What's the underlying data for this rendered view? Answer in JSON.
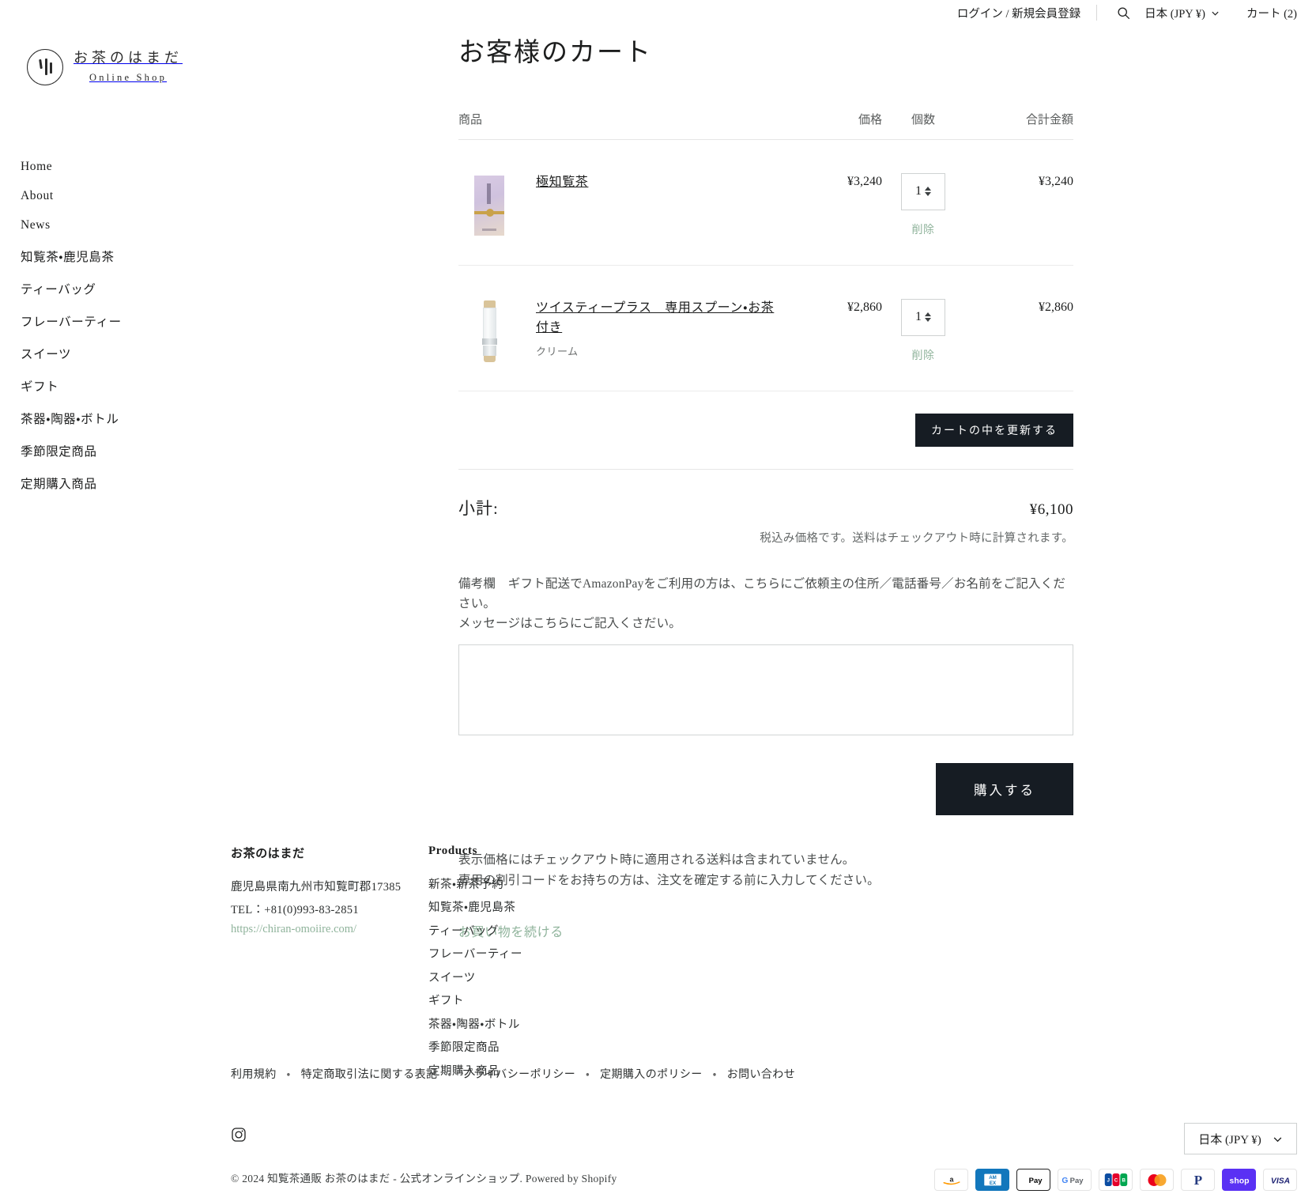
{
  "topbar": {
    "account_label": "ログイン / 新規会員登録",
    "search_icon": "search-icon",
    "currency_label": "日本 (JPY ¥)",
    "cart_label": "カート (2)"
  },
  "logo": {
    "main": "お茶のはまだ",
    "sub": "Online Shop"
  },
  "sidebar": {
    "items": [
      {
        "label": "Home"
      },
      {
        "label": "About"
      },
      {
        "label": "News"
      },
      {
        "label": "知覧茶・鹿児島茶"
      },
      {
        "label": "ティーバッグ"
      },
      {
        "label": "フレーバーティー"
      },
      {
        "label": "スイーツ"
      },
      {
        "label": "ギフト"
      },
      {
        "label": "茶器・陶器・ボトル"
      },
      {
        "label": "季節限定商品"
      },
      {
        "label": "定期購入商品"
      }
    ]
  },
  "cart": {
    "title": "お客様のカート",
    "columns": {
      "product": "商品",
      "price": "価格",
      "quantity": "個数",
      "total": "合計金額"
    },
    "items": [
      {
        "name": "極知覧茶",
        "variant": "",
        "price": "¥3,240",
        "quantity": "1",
        "line_total": "¥3,240",
        "remove_label": "削除",
        "thumb": "tea-box-thumbnail"
      },
      {
        "name": "ツイスティープラス　専用スプーン・お茶付き",
        "variant": "クリーム",
        "price": "¥2,860",
        "quantity": "1",
        "line_total": "¥2,860",
        "remove_label": "削除",
        "thumb": "tea-bottle-thumbnail"
      }
    ],
    "update_button": "カートの中を更新する",
    "subtotal_label": "小計:",
    "subtotal_value": "¥6,100",
    "tax_note": "税込み価格です。送料はチェックアウト時に計算されます。",
    "note_label_line1": "備考欄　ギフト配送でAmazonPayをご利用の方は、こちらにご依頼主の住所／電話番号／お名前をご記入ください。",
    "note_label_line2": "メッセージはこちらにご記入くさだい。",
    "note_value": "",
    "note_placeholder": "",
    "checkout_button": "購入する",
    "shipping_note_line1": "表示価格にはチェックアウト時に適用される送料は含まれていません。",
    "shipping_note_line2": "専用の割引コードをお持ちの方は、注文を確定する前に入力してください。",
    "continue_link": "お買い物を続ける"
  },
  "footer": {
    "brand_heading": "お茶のはまだ",
    "address": "鹿児島県南九州市知覧町郡17385",
    "tel": "TEL：+81(0)993-83-2851",
    "url": "https://chiran-omoiire.com/",
    "products_heading": "Products",
    "product_links": [
      "新茶・新茶予約",
      "知覧茶・鹿児島茶",
      "ティーバッグ",
      "フレーバーティー",
      "スイーツ",
      "ギフト",
      "茶器・陶器・ボトル",
      "季節限定商品",
      "定期購入商品"
    ],
    "policy_links": [
      "利用規約",
      "特定商取引法に関する表記",
      "プライバシーポリシー",
      "定期購入のポリシー",
      "お問い合わせ"
    ],
    "policy_separator": "・",
    "social_icon": "instagram-icon",
    "copyright_prefix": "© 2024",
    "copyright_shop": "知覧茶通販 お茶のはまだ - 公式オンラインショップ",
    "copyright_suffix": ". Powered by Shopify",
    "currency_label": "日本 (JPY ¥)",
    "payment_icons": [
      "amazon-pay-icon",
      "american-express-icon",
      "apple-pay-icon",
      "google-pay-icon",
      "jcb-icon",
      "mastercard-icon",
      "paypal-icon",
      "shop-pay-icon",
      "visa-icon"
    ]
  },
  "colors": {
    "accent_green": "#8fb39b",
    "button_dark": "#161c23",
    "text": "#1c1d1d",
    "muted": "#646868"
  }
}
